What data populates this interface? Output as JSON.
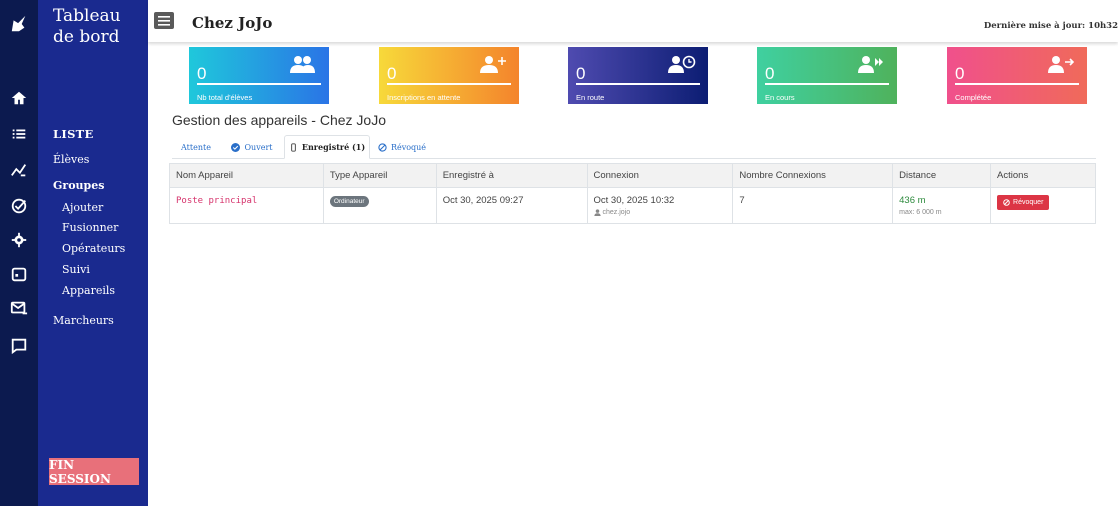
{
  "app": {
    "title_line1": "Tableau",
    "title_line2": "de bord"
  },
  "rail": {
    "icons": [
      "unicorn-logo-icon",
      "home-icon",
      "list-icon",
      "chart-icon",
      "check-circle-icon",
      "gear-icon",
      "calendar-icon",
      "mail-icon",
      "chat-icon"
    ]
  },
  "nav": {
    "list_title": "LISTE",
    "items": [
      {
        "label": "Élèves"
      },
      {
        "label": "Groupes"
      },
      {
        "label": "Ajouter"
      },
      {
        "label": "Fusionner"
      },
      {
        "label": "Opérateurs"
      },
      {
        "label": "Suivi"
      },
      {
        "label": "Appareils"
      },
      {
        "label": "Marcheurs"
      }
    ],
    "fin_session": "FIN SESSION"
  },
  "header": {
    "title": "Chez JoJo",
    "updated": "Dernière mise à jour: 10h32"
  },
  "cards": [
    {
      "value": "0",
      "label": "Nb total d'élèves",
      "icon": "users-icon",
      "color_from": "#1fc8db",
      "color_to": "#2a74e6"
    },
    {
      "value": "0",
      "label": "Inscriptions en attente",
      "icon": "user-plus-icon",
      "color_from": "#f7d93a",
      "color_to": "#f4842c"
    },
    {
      "value": "0",
      "label": "En route",
      "icon": "user-clock-icon",
      "color_from": "#4f4bb0",
      "color_to": "#0c1d73"
    },
    {
      "value": "0",
      "label": "En cours",
      "icon": "user-forward-icon",
      "color_from": "#3fd0a0",
      "color_to": "#4fb25c"
    },
    {
      "value": "0",
      "label": "Complétée",
      "icon": "user-arrow-icon",
      "color_from": "#f0508c",
      "color_to": "#f06a5a"
    }
  ],
  "section": {
    "title": "Gestion des appareils - Chez JoJo"
  },
  "tabs": [
    {
      "label": "Attente"
    },
    {
      "label": "Ouvert"
    },
    {
      "label": "Enregistré (1)"
    },
    {
      "label": "Révoqué"
    }
  ],
  "table": {
    "headers": [
      "Nom Appareil",
      "Type Appareil",
      "Enregistré à",
      "Connexion",
      "Nombre Connexions",
      "Distance",
      "Actions"
    ],
    "rows": [
      {
        "name": "Poste principal",
        "type": "Ordinateur",
        "registered": "Oct 30, 2025 09:27",
        "connection": "Oct 30, 2025 10:32",
        "connection_user": "chez.jojo",
        "count": "7",
        "distance": "436 m",
        "distance_max": "max: 6 000 m",
        "action": "Révoquer"
      }
    ]
  },
  "colors": {
    "rail": "#0c1a4f",
    "nav": "#1a2a8f",
    "fin_session": "#e8707a",
    "link": "#2a6fc9",
    "danger": "#dc3545"
  }
}
